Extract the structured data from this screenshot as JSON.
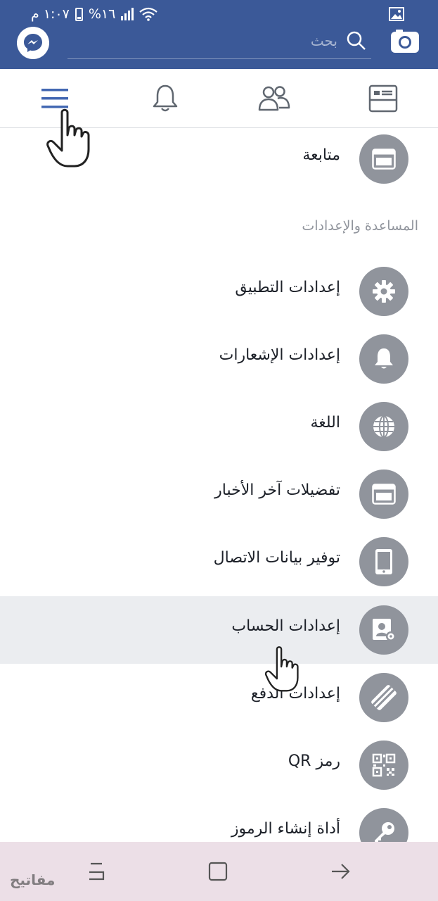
{
  "status_bar": {
    "time": "١:٠٧ م",
    "battery": "%١٦"
  },
  "header": {
    "search_placeholder": "بحث"
  },
  "tabs": [
    {
      "name": "menu",
      "icon": "hamburger-menu-icon",
      "active": true
    },
    {
      "name": "notifications",
      "icon": "bell-icon"
    },
    {
      "name": "friends",
      "icon": "friends-icon"
    },
    {
      "name": "news-feed",
      "icon": "news-feed-icon"
    }
  ],
  "menu": {
    "follow_label": "متابعة",
    "section_title": "المساعدة والإعدادات",
    "items": [
      {
        "label": "إعدادات التطبيق",
        "icon": "gear-icon"
      },
      {
        "label": "إعدادات الإشعارات",
        "icon": "bell-icon"
      },
      {
        "label": "اللغة",
        "icon": "globe-icon"
      },
      {
        "label": "تفضيلات آخر الأخبار",
        "icon": "news-feed-icon"
      },
      {
        "label": "توفير بيانات الاتصال",
        "icon": "phone-icon"
      },
      {
        "label": "إعدادات الحساب",
        "icon": "account-settings-icon",
        "highlighted": true
      },
      {
        "label": "إعدادات الدفع",
        "icon": "payment-icon"
      },
      {
        "label": "رمز QR",
        "icon": "qr-code-icon"
      },
      {
        "label": "أداة إنشاء الرموز",
        "icon": "key-icon"
      }
    ]
  },
  "watermark": "مفاتيح",
  "colors": {
    "brand_blue": "#3b5998",
    "icon_circle": "#90949c",
    "active_tab": "#4267b2",
    "highlight_row": "#ebedf0"
  }
}
